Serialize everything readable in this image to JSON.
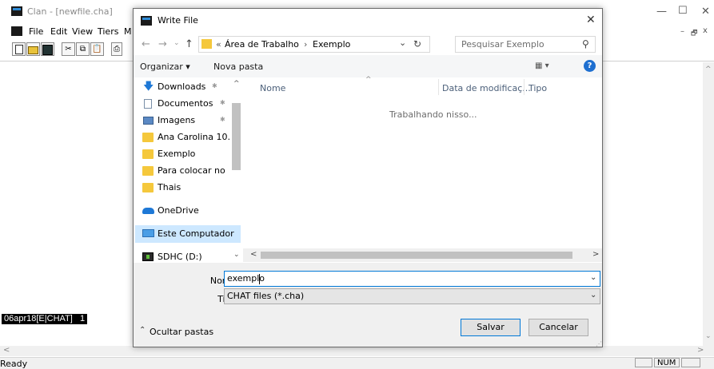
{
  "app": {
    "title": "Clan - [newfile.cha]",
    "menu": [
      "File",
      "Edit",
      "View",
      "Tiers",
      "M"
    ],
    "toolbar_icons": [
      "new-icon",
      "open-icon",
      "save-icon",
      "cut-icon",
      "copy-icon",
      "paste-icon",
      "print-icon"
    ],
    "tier_label": "06apr18[E|CHAT]   1",
    "status": {
      "ready": "Ready",
      "num": "NUM"
    },
    "window_controls": {
      "minimize": "—",
      "maximize": "☐",
      "close": "✕",
      "inner_minimize": "–",
      "inner_restore": "🗗",
      "inner_close": "x"
    }
  },
  "dialog": {
    "title": "Write File",
    "close_glyph": "✕",
    "nav": {
      "back": "←",
      "forward": "→",
      "dropdown": "⌄",
      "up": "↑"
    },
    "breadcrumb": {
      "prefix": "«",
      "items": [
        "Área de Trabalho",
        "Exemplo"
      ],
      "separator": "›"
    },
    "refresh_glyph": "↻",
    "search_placeholder": "Pesquisar Exemplo",
    "search_icon": "⚲",
    "commands": {
      "organize": "Organizar ▾",
      "new_folder": "Nova pasta",
      "view_glyph": "▦ ▾",
      "help": "?"
    },
    "nav_items": [
      {
        "label": "Downloads",
        "icon": "download-icon",
        "pinned": true
      },
      {
        "label": "Documentos",
        "icon": "documents-icon",
        "pinned": true
      },
      {
        "label": "Imagens",
        "icon": "pictures-icon",
        "pinned": true
      },
      {
        "label": "Ana Carolina 10.",
        "icon": "folder-icon",
        "pinned": false
      },
      {
        "label": "Exemplo",
        "icon": "folder-icon",
        "pinned": false
      },
      {
        "label": "Para colocar no",
        "icon": "folder-icon",
        "pinned": false
      },
      {
        "label": "Thais",
        "icon": "folder-icon",
        "pinned": false
      },
      {
        "label": "OneDrive",
        "icon": "onedrive-icon",
        "pinned": false
      },
      {
        "label": "Este Computador",
        "icon": "computer-icon",
        "pinned": false
      },
      {
        "label": "SDHC (D:)",
        "icon": "drive-icon",
        "pinned": false
      }
    ],
    "pin_glyph": "✱",
    "columns": {
      "name": "Nome",
      "date": "Data de modificaç...",
      "type": "Tipo"
    },
    "empty_message": "Trabalhando nisso...",
    "filename": {
      "label": "Nome:",
      "value": "exemplo"
    },
    "filetype": {
      "label": "Tipo:",
      "value": "CHAT files (*.cha)"
    },
    "hide_folders": "Ocultar pastas",
    "save": "Salvar",
    "cancel": "Cancelar",
    "scroll_glyphs": {
      "up": "^",
      "down": "⌄",
      "left": "<",
      "right": ">"
    }
  }
}
